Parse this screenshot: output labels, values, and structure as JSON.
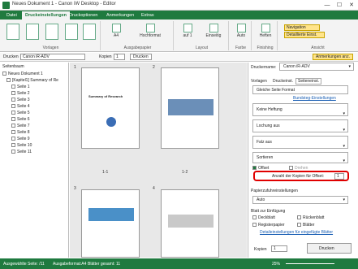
{
  "title_bar": {
    "title": "Neues Dokument 1 - Canon iW Desktop - Editor",
    "minimize": "—",
    "maximize": "☐",
    "close": "✕"
  },
  "ribbon_tabs": [
    "Datei",
    "Druckeinstellungen",
    "Druckoptionen",
    "Anmerkungen",
    "Extras"
  ],
  "ribbon": {
    "vorlagen_label": "Vorlagen",
    "paper_size": "A4",
    "orientation": "Hochformat",
    "layout_value": "1",
    "layout_sub": "auf 1",
    "sides": "Einseitig",
    "ausgabepapier_label": "Ausgabepapier",
    "layout_label": "Layout",
    "color": "Auto",
    "farbe_label": "Farbe",
    "heften": "Heften",
    "finishing_label": "Finishing",
    "navigation": "Navigation",
    "detail": "Detaillierte Einst.",
    "ansicht_label": "Ansicht"
  },
  "print_bar": {
    "printer_label": "Drucken",
    "printer": "Canon iR-ADV",
    "copies_label": "Kopien",
    "copies": "1",
    "print_button": "Drucken",
    "annotations_button": "Anmerkungen anz."
  },
  "left_pane": {
    "header": "Seitenbaum",
    "doc": "Neues Dokument 1",
    "chapter": "[Kapitel1] Summary of Re",
    "pages": [
      "Seite 1",
      "Seite 2",
      "Seite 3",
      "Seite 4",
      "Seite 5",
      "Seite 6",
      "Seite 7",
      "Seite 8",
      "Seite 9",
      "Seite 10",
      "Seite 11"
    ]
  },
  "preview": {
    "pages": [
      "1",
      "2",
      "3",
      "4"
    ],
    "labels": [
      "1-1",
      "1-2"
    ],
    "p1_title": "Summary of Research"
  },
  "right_pane": {
    "printer_label": "Druckername:",
    "printer": "Canon iR-ADV",
    "tabs": [
      "Vorlagen",
      "Druckeinst.",
      "Seiteneinst."
    ],
    "top_option": "Gleiche Seite Format",
    "link1": "Bundsteg-Einstellungen",
    "stapling": "Keine Heftung",
    "punch": "Lochung aus",
    "fold": "Falz aus",
    "sort": "Sortieren",
    "offset_label": "Offset",
    "rotate_label": "Drehen",
    "copies_offset_label": "Anzahl der Kopien für Offset:",
    "copies_offset_value": "1",
    "paper_section": "Papierzufuhreinstellungen",
    "paper_value": "Auto",
    "insert_section": "Blatt zur Einfügung",
    "cover_label": "Deckblatt",
    "back_label": "Rückenblatt",
    "tab_paper_label": "Registerpapier",
    "sheets_label": "Blätter",
    "link2": "Detaileinstellungen für eingefügte Blätter",
    "copies_label": "Kopien",
    "copies_value": "1",
    "print_button": "Drucken"
  },
  "status_bar": {
    "selected": "Ausgewählte Seite: /11",
    "format": "Ausgabeformat:A4",
    "sheets": "Blätter gesamt: 11",
    "zoom": "25%"
  }
}
